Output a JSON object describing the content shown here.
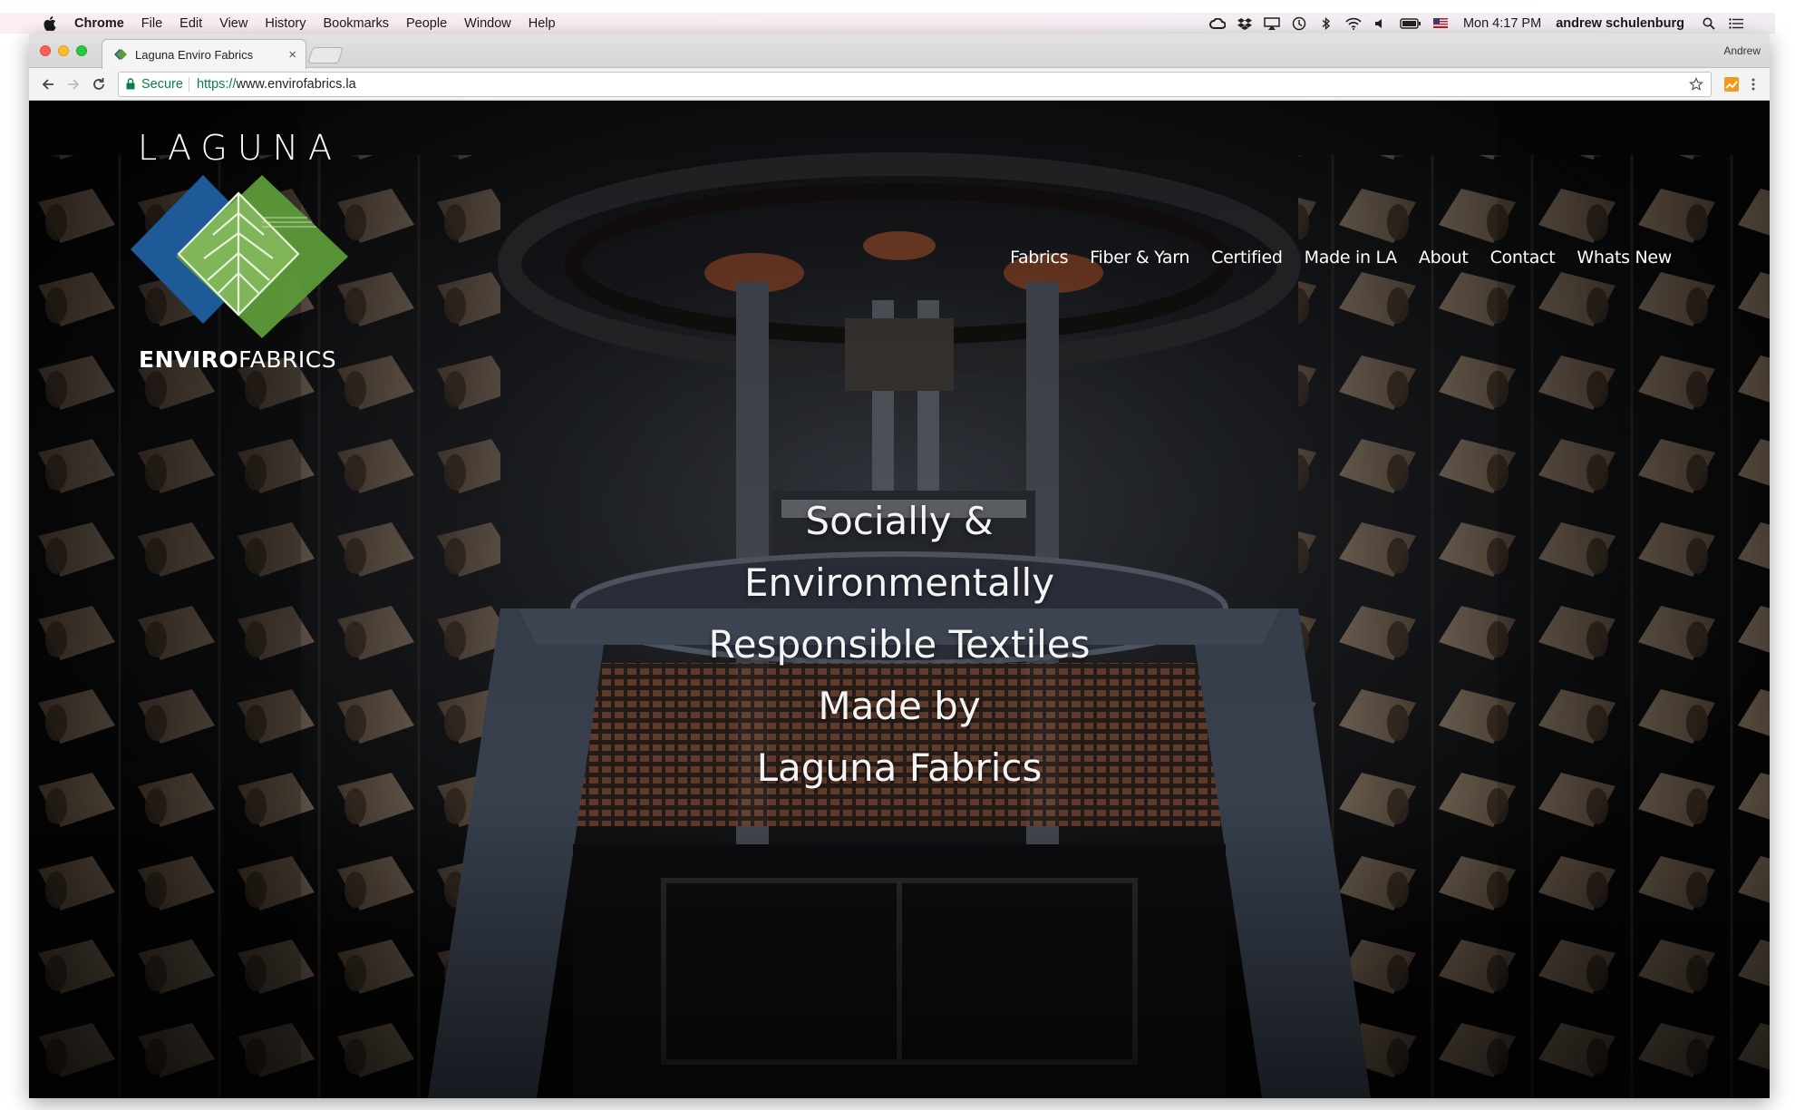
{
  "menubar": {
    "app_name": "Chrome",
    "items": [
      "File",
      "Edit",
      "View",
      "History",
      "Bookmarks",
      "People",
      "Window",
      "Help"
    ],
    "clock": "Mon 4:17 PM",
    "user": "andrew schulenburg",
    "status_icons": [
      "creative-cloud-icon",
      "dropbox-icon",
      "airplay-icon",
      "time-machine-icon",
      "bluetooth-icon",
      "wifi-icon",
      "volume-icon",
      "battery-icon",
      "flag-icon",
      "spotlight-icon",
      "notification-center-icon"
    ]
  },
  "browser": {
    "tab_title": "Laguna Enviro Fabrics",
    "tab_close": "×",
    "profile_name": "Andrew",
    "secure_label": "Secure",
    "url_scheme": "https://",
    "url_host": "www.envirofabrics.la"
  },
  "site": {
    "logo_top": "LAGUNA",
    "logo_bottom_bold": "ENVIRO",
    "logo_bottom_regular": "FABRICS",
    "logo_colors": {
      "blue": "#1d5a97",
      "green": "#5d9a3a",
      "light_green": "#8fbf63"
    },
    "nav": [
      "Fabrics",
      "Fiber & Yarn",
      "Certified",
      "Made in LA",
      "About",
      "Contact",
      "Whats New"
    ],
    "headline_lines": [
      "Socially &",
      "Environmentally",
      "Responsible Textiles",
      "Made by",
      "Laguna Fabrics"
    ]
  }
}
